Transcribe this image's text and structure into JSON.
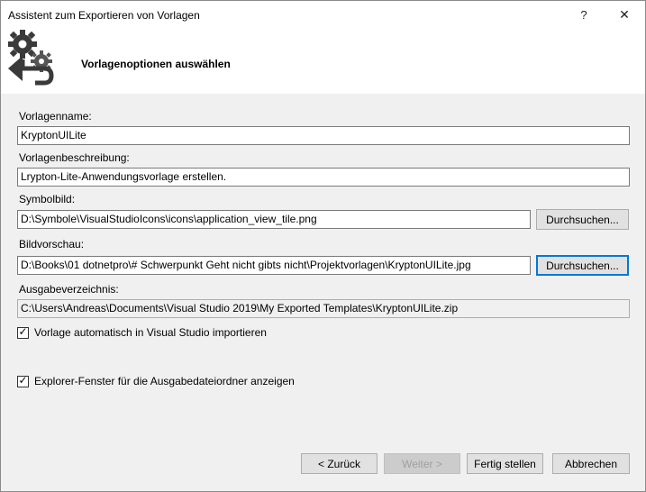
{
  "window": {
    "title": "Assistent zum Exportieren von Vorlagen",
    "help_glyph": "?",
    "close_glyph": "✕"
  },
  "header": {
    "page_title": "Vorlagenoptionen auswählen",
    "icon": "gears-back-arrow-icon"
  },
  "form": {
    "template_name_label": "Vorlagenname:",
    "template_name_value": "KryptonUILite",
    "description_label": "Vorlagenbeschreibung:",
    "description_value": "Lrypton-Lite-Anwendungsvorlage erstellen.",
    "icon_label": "Symbolbild:",
    "icon_value": "D:\\Symbole\\VisualStudioIcons\\icons\\application_view_tile.png",
    "icon_browse": "Durchsuchen...",
    "preview_label": "Bildvorschau:",
    "preview_value": "D:\\Books\\01 dotnetpro\\# Schwerpunkt Geht nicht gibts nicht\\Projektvorlagen\\KryptonUILite.jpg",
    "preview_browse": "Durchsuchen...",
    "output_label": "Ausgabeverzeichnis:",
    "output_value": "C:\\Users\\Andreas\\Documents\\Visual Studio 2019\\My Exported Templates\\KryptonUILite.zip"
  },
  "options": {
    "auto_import_label": "Vorlage automatisch in Visual Studio importieren",
    "auto_import_checked": true,
    "explorer_label": "Explorer-Fenster für die Ausgabedateiordner anzeigen",
    "explorer_checked": true,
    "check_glyph": "✓"
  },
  "footer": {
    "back": "< Zurück",
    "next": "Weiter >",
    "finish": "Fertig stellen",
    "cancel": "Abbrechen"
  }
}
